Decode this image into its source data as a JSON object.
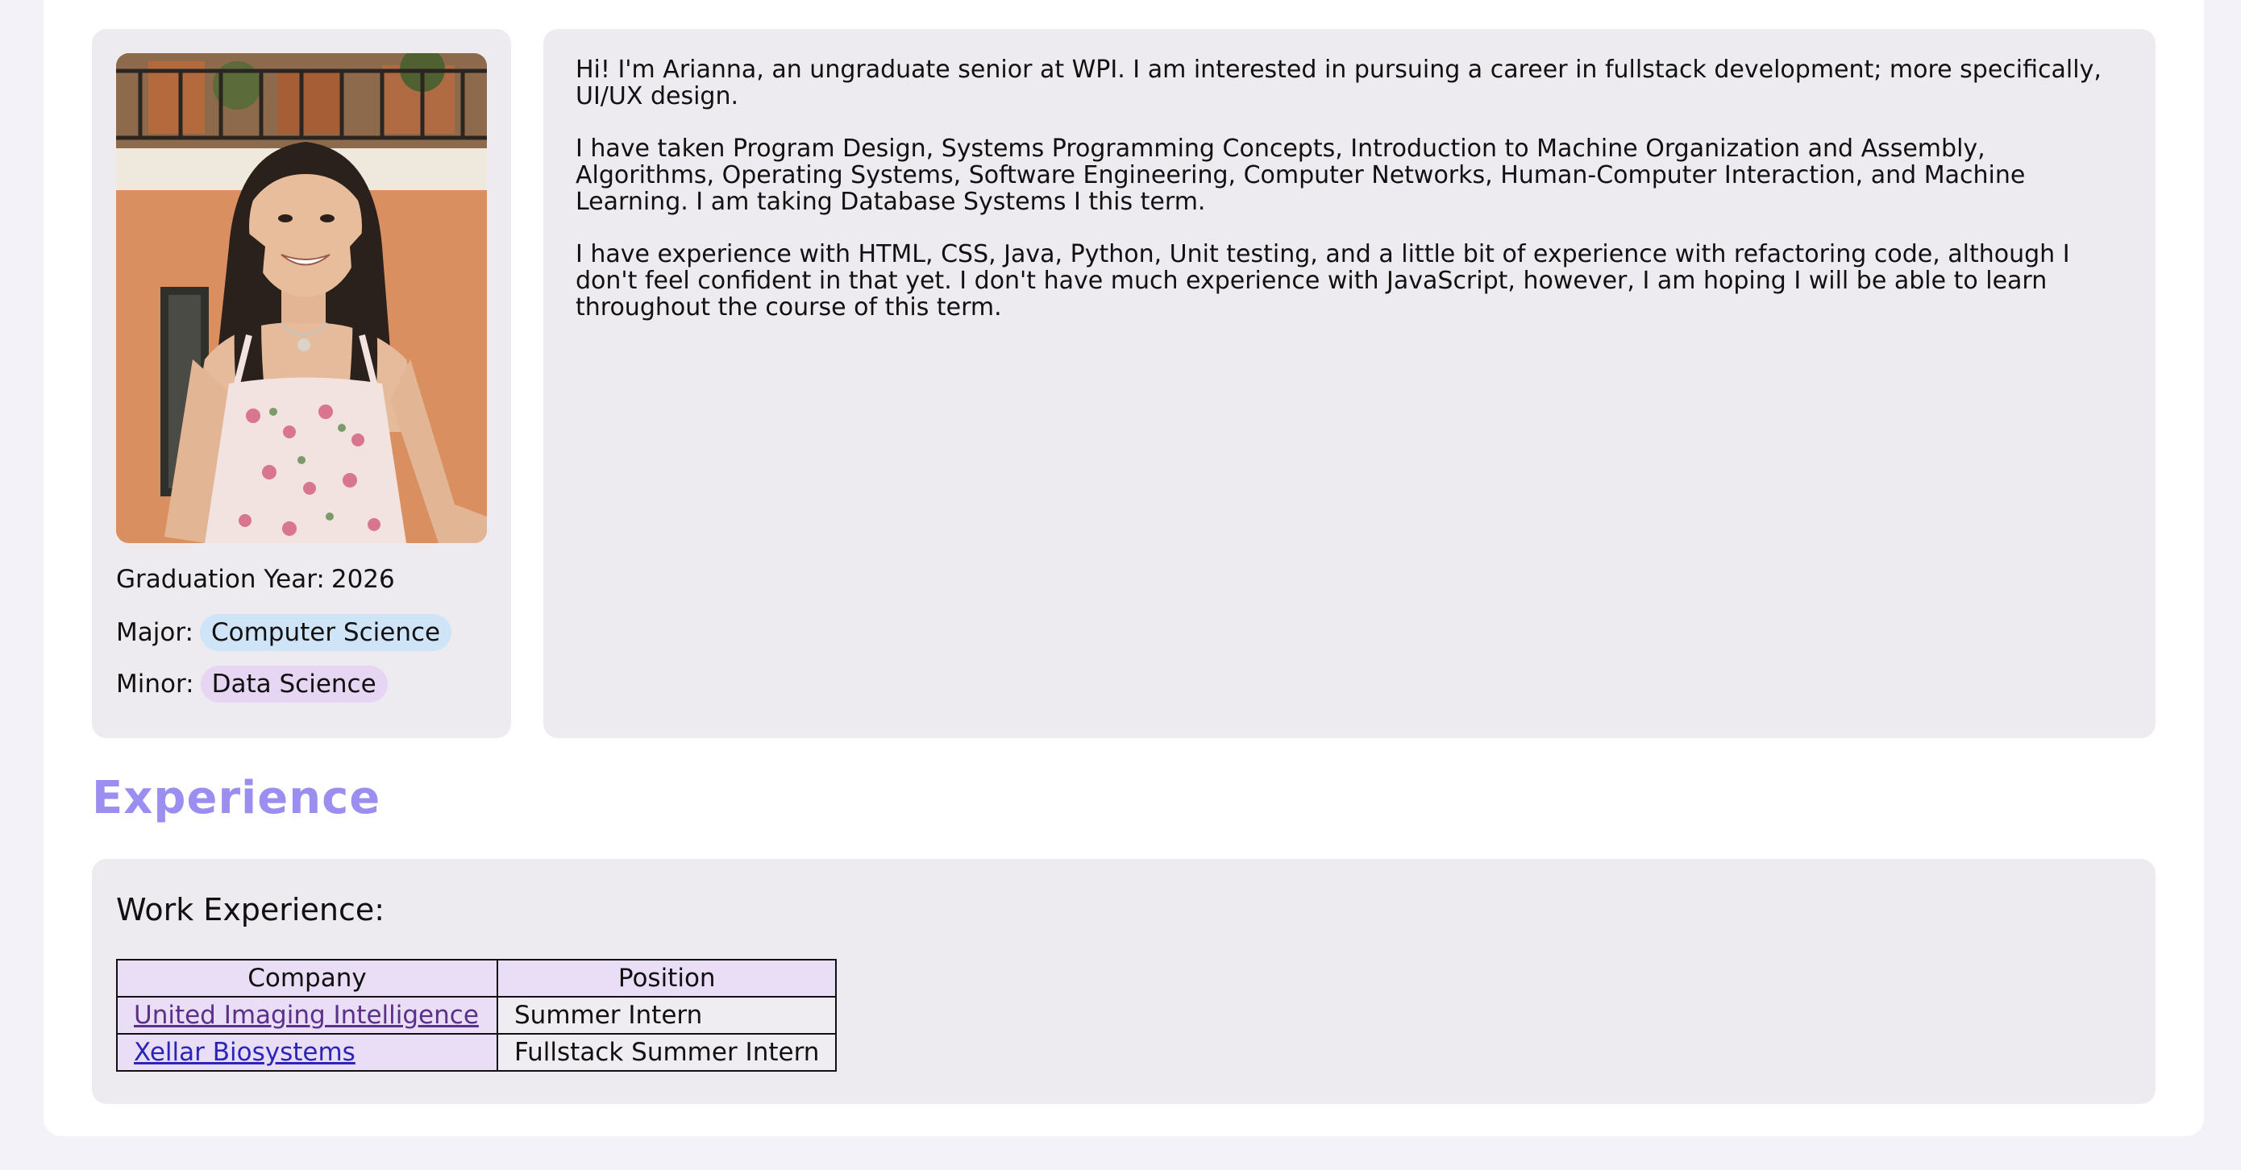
{
  "profile": {
    "photo_alt": "profile-photo",
    "graduation_label": "Graduation Year:",
    "graduation_value": "2026",
    "major_label": "Major:",
    "major_value": "Computer Science",
    "minor_label": "Minor:",
    "minor_value": "Data Science"
  },
  "about": {
    "paragraphs": [
      "Hi! I'm Arianna, an ungraduate senior at WPI. I am interested in pursuing a career in fullstack development; more specifically, UI/UX design.",
      "I have taken Program Design, Systems Programming Concepts, Introduction to Machine Organization and Assembly, Algorithms, Operating Systems, Software Engineering, Computer Networks, Human-Computer Interaction, and Machine Learning. I am taking Database Systems I this term.",
      "I have experience with HTML, CSS, Java, Python, Unit testing, and a little bit of experience with refactoring code, although I don't feel confident in that yet. I don't have much experience with JavaScript, however, I am hoping I will be able to learn throughout the course of this term."
    ]
  },
  "experience": {
    "section_title": "Experience",
    "work_heading": "Work Experience:",
    "columns": [
      "Company",
      "Position"
    ],
    "rows": [
      {
        "company": "United Imaging Intelligence",
        "position": "Summer Intern"
      },
      {
        "company": "Xellar Biosystems",
        "position": "Fullstack Summer Intern"
      }
    ]
  },
  "colors": {
    "page_background": "#f4f2f9",
    "card_background": "#edebef",
    "section_title": "#9a8ff0",
    "major_pill": "#cfe5f7",
    "minor_pill": "#e6d6f3",
    "table_header": "#e9def6",
    "link_visited": "#5b2f8c",
    "link": "#2a25b8"
  }
}
